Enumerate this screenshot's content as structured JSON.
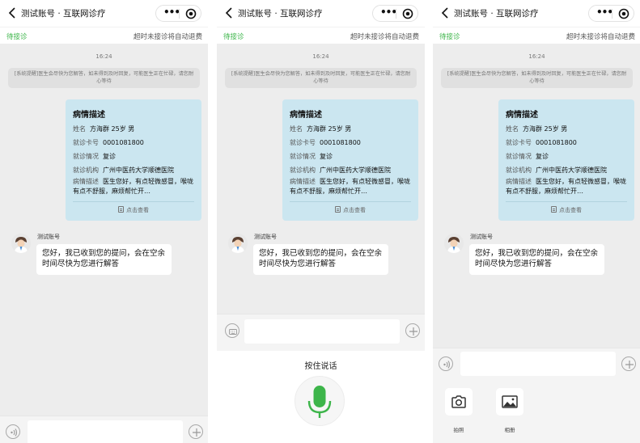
{
  "nav": {
    "title": "测试账号 · 互联网诊疗",
    "menu_glyph": "•••"
  },
  "status": {
    "left": "待接诊",
    "right": "超时未接诊将自动退费"
  },
  "chat": {
    "time": "16:24",
    "system_message": "[系统提醒]医生会尽快为您解答，如未得到及时回复，可能医生正在忙碌，请您耐心等待"
  },
  "card": {
    "title": "病情描述",
    "rows": [
      {
        "label": "姓名",
        "value": "方海群 25岁 男"
      },
      {
        "label": "就诊卡号",
        "value": "0001081800"
      },
      {
        "label": "就诊情况",
        "value": "复诊"
      },
      {
        "label": "就诊机构",
        "value": "广州中医药大学顺德医院"
      }
    ],
    "desc_label": "病情描述",
    "desc_value": "医生您好，有点轻微感冒，喉咙有点不舒服，麻烦帮忙开…",
    "view_label": "点击查看"
  },
  "reply": {
    "sender": "测试账号",
    "text": "您好，我已收到您的提问，会在空余时间尽快为您进行解答"
  },
  "voice": {
    "hint": "按住说话"
  },
  "more": {
    "camera_label": "拍照",
    "album_label": "相册"
  },
  "colors": {
    "accent_green": "#3db54a",
    "card_bg": "#cbe6f0",
    "page_bg": "#ededed"
  }
}
